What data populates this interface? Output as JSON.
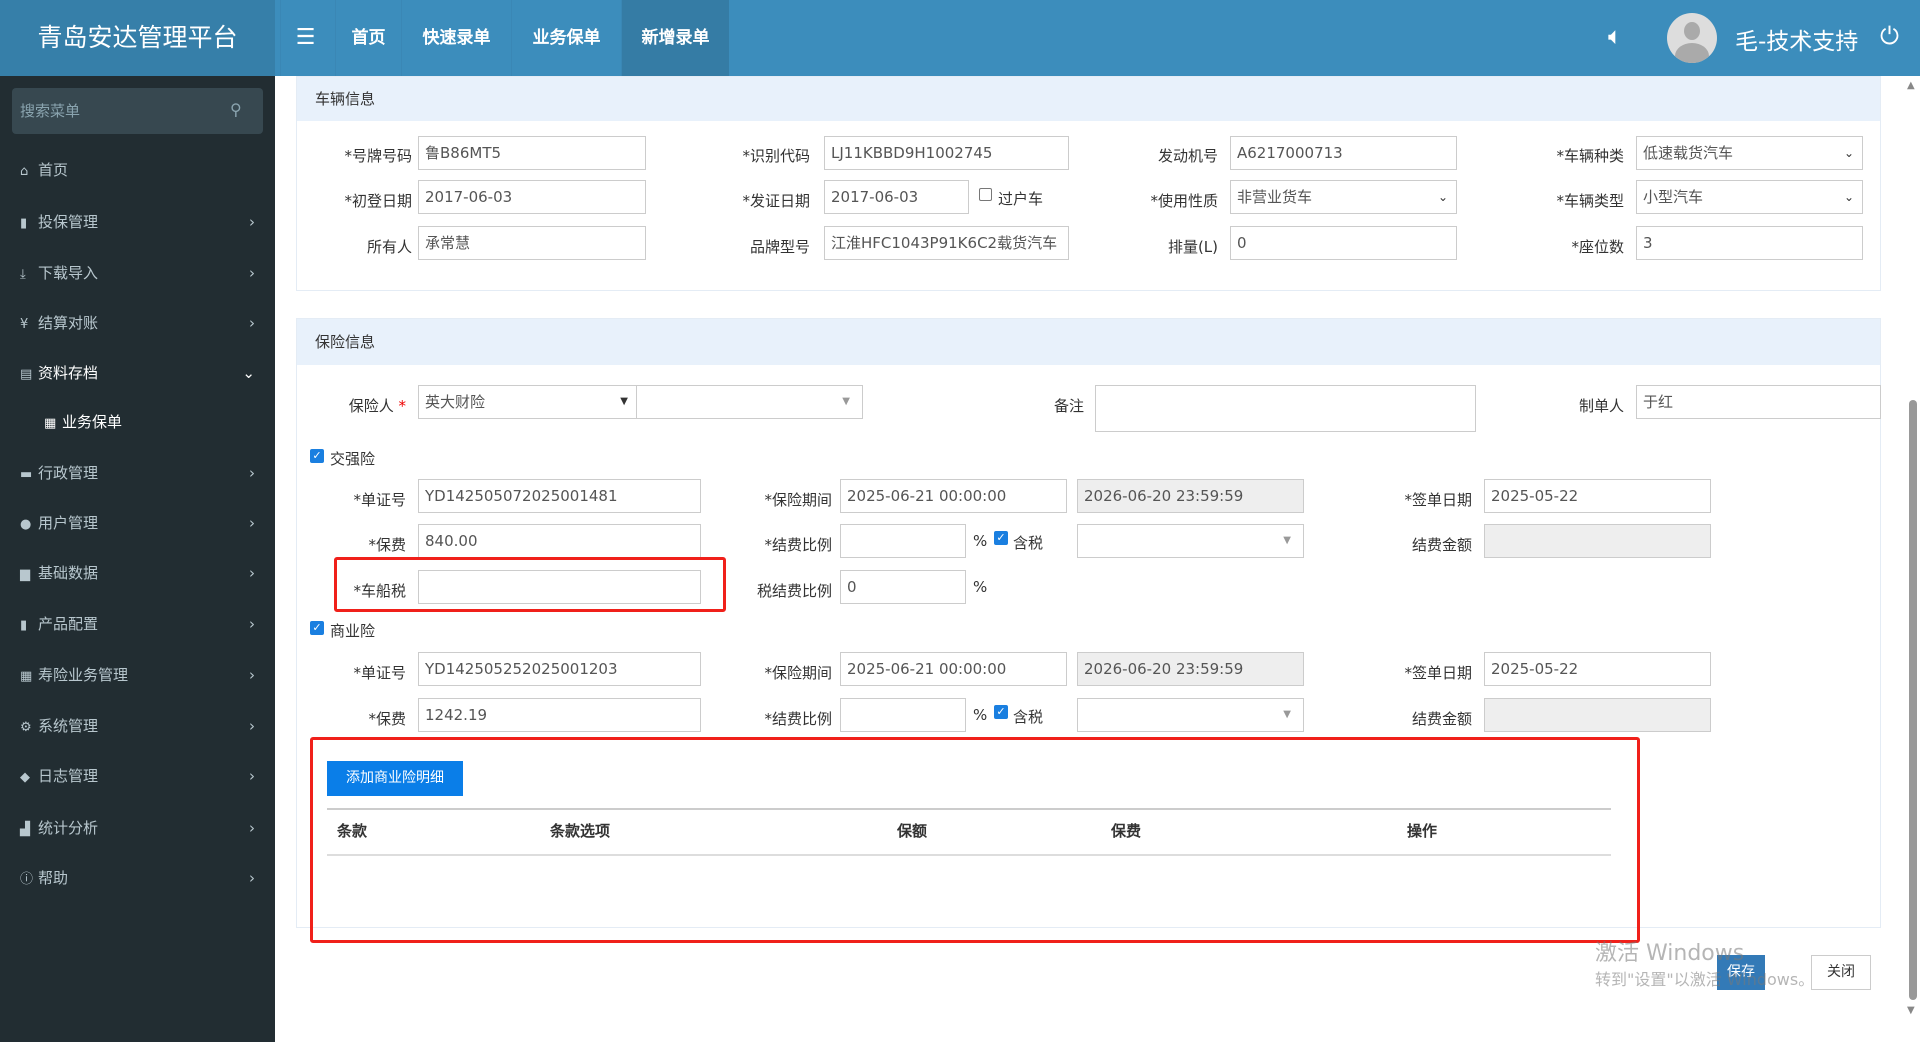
{
  "header": {
    "logo": "青岛安达管理平台",
    "nav": [
      "首页",
      "快速录单",
      "业务保单",
      "新增录单"
    ],
    "active_nav": "新增录单",
    "user": "毛-技术支持",
    "icons": [
      "menu-icon",
      "speaker-icon",
      "avatar",
      "power-icon"
    ],
    "color": "#3c8dbc"
  },
  "sidebar": {
    "search_placeholder": "搜索菜单",
    "items": [
      {
        "label": "首页",
        "icon": "home-icon"
      },
      {
        "label": "投保管理",
        "icon": "file-icon"
      },
      {
        "label": "下载导入",
        "icon": "download-icon"
      },
      {
        "label": "结算对账",
        "icon": "yen-icon"
      },
      {
        "label": "资料存档",
        "icon": "archive-icon",
        "expanded": true
      },
      {
        "label": "业务保单",
        "icon": "grid-icon",
        "sub": true
      },
      {
        "label": "行政管理",
        "icon": "briefcase-icon"
      },
      {
        "label": "用户管理",
        "icon": "user-icon"
      },
      {
        "label": "基础数据",
        "icon": "drive-icon"
      },
      {
        "label": "产品配置",
        "icon": "book-icon"
      },
      {
        "label": "寿险业务管理",
        "icon": "grid-icon"
      },
      {
        "label": "系统管理",
        "icon": "gear-icon"
      },
      {
        "label": "日志管理",
        "icon": "tags-icon"
      },
      {
        "label": "统计分析",
        "icon": "chart-icon"
      },
      {
        "label": "帮助",
        "icon": "info-icon"
      }
    ]
  },
  "vehicle": {
    "title": "车辆信息",
    "plate_label": "*号牌号码",
    "plate": "鲁B86MT5",
    "vin_label": "*识别代码",
    "vin": "LJ11KBBD9H1002745",
    "engine_label": "发动机号",
    "engine": "A6217000713",
    "kind_label": "*车辆种类",
    "kind": "低速载货汽车",
    "reg_label": "*初登日期",
    "reg": "2017-06-03",
    "cert_label": "*发证日期",
    "cert": "2017-06-03",
    "transfer_label": "过户车",
    "use_label": "*使用性质",
    "use": "非营业货车",
    "type_label": "*车辆类型",
    "type": "小型汽车",
    "owner_label": "所有人",
    "owner": "承常慧",
    "model_label": "品牌型号",
    "model": "江淮HFC1043P91K6C2载货汽车",
    "disp_label": "排量(L)",
    "disp": "0",
    "seats_label": "*座位数",
    "seats": "3"
  },
  "insurance": {
    "title": "保险信息",
    "insurer_label": "保险人",
    "insurer_required": "*",
    "insurer": "英大财险",
    "remark_label": "备注",
    "remark": "",
    "maker_label": "制单人",
    "maker": "于红",
    "ci": {
      "label": "交强险",
      "checked": true,
      "no_label": "*单证号",
      "no": "YD142505072025001481",
      "period_label": "*保险期间",
      "start": "2025-06-21 00:00:00",
      "end": "2026-06-20 23:59:59",
      "sign_label": "*签单日期",
      "sign": "2025-05-22",
      "premium_label": "*保费",
      "premium": "840.00",
      "rate_label": "*结费比例",
      "rate": "",
      "pct": "%",
      "tax_incl_label": "含税",
      "tax_incl": true,
      "fee_label": "结费金额",
      "fee": "",
      "vvt_label": "*车船税",
      "vvt": "",
      "tax_rate_label": "税结费比例",
      "tax_rate": "0"
    },
    "bi": {
      "label": "商业险",
      "checked": true,
      "no_label": "*单证号",
      "no": "YD142505252025001203",
      "period_label": "*保险期间",
      "start": "2025-06-21 00:00:00",
      "end": "2026-06-20 23:59:59",
      "sign_label": "*签单日期",
      "sign": "2025-05-22",
      "premium_label": "*保费",
      "premium": "1242.19",
      "rate_label": "*结费比例",
      "rate": "",
      "pct": "%",
      "tax_incl_label": "含税",
      "tax_incl": true,
      "fee_label": "结费金额",
      "fee": ""
    },
    "add_detail": "添加商业险明细",
    "columns": [
      "条款",
      "条款选项",
      "保额",
      "保费",
      "操作"
    ],
    "rows": []
  },
  "footer": {
    "save": "保存",
    "close": "关闭"
  },
  "watermark": {
    "line1": "激活 Windows",
    "line2": "转到\"设置\"以激活 Windows。"
  }
}
